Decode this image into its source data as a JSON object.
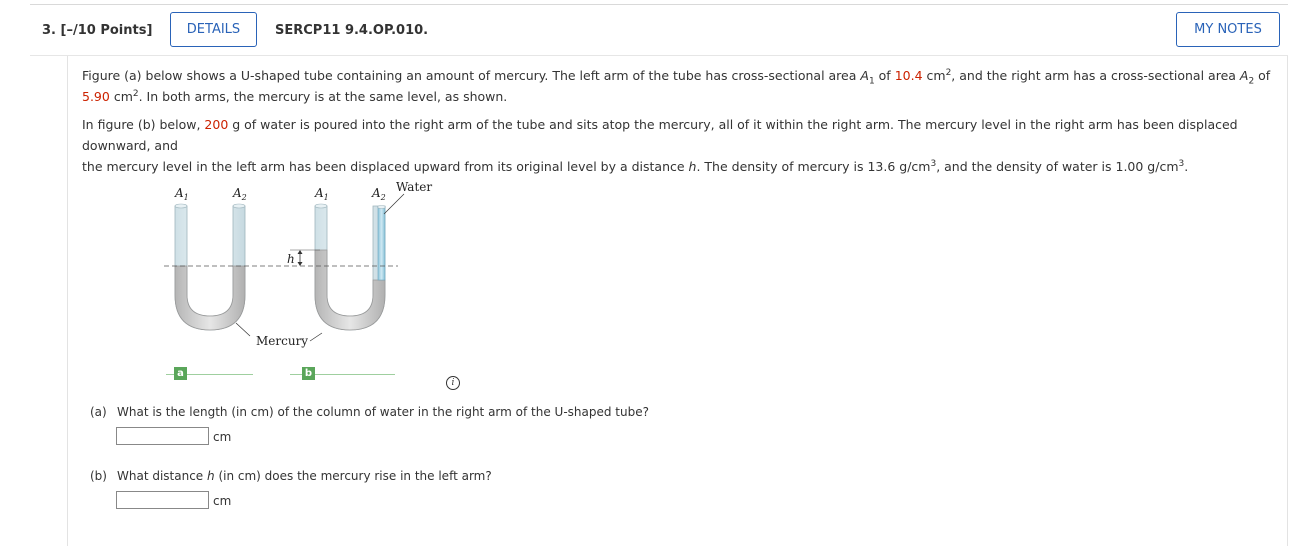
{
  "header": {
    "question_number": "3. [–/10 Points]",
    "details_label": "DETAILS",
    "question_id": "SERCP11 9.4.OP.010.",
    "my_notes_label": "MY NOTES"
  },
  "problem": {
    "p1_a": "Figure (a) below shows a U-shaped tube containing an amount of mercury. The left arm of the tube has cross-sectional area ",
    "p1_var1": "A",
    "p1_sub1": "1",
    "p1_b": " of ",
    "p1_val1": "10.4",
    "p1_c": " cm",
    "p1_sup1": "2",
    "p1_d": ", and the right arm has a cross-sectional area ",
    "p1_var2": "A",
    "p1_sub2": "2",
    "p1_e": " of",
    "p1_val2": "5.90",
    "p1_f": " cm",
    "p1_sup2": "2",
    "p1_g": ". In both arms, the mercury is at the same level, as shown.",
    "p2_a": "In figure (b) below, ",
    "p2_val": "200",
    "p2_b": " g of water is poured into the right arm of the tube and sits atop the mercury, all of it within the right arm. The mercury level in the right arm has been displaced downward, and",
    "p2_c": "the mercury level in the left arm has been displaced upward from its original level by a distance ",
    "p2_h": "h",
    "p2_d": ". The density of mercury is 13.6 g/cm",
    "p2_sup1": "3",
    "p2_e": ", and the density of water is 1.00 g/cm",
    "p2_sup2": "3",
    "p2_f": "."
  },
  "figure": {
    "label_a1": "A",
    "label_a1_sub": "1",
    "label_a2": "A",
    "label_a2_sub": "2",
    "label_b1": "A",
    "label_b1_sub": "1",
    "label_b2": "A",
    "label_b2_sub": "2",
    "water_label": "Water",
    "h_label": "h",
    "mercury_label": "Mercury",
    "tab_a": "a",
    "tab_b": "b",
    "colors": {
      "tube": "#d9e6ea",
      "mercury": "#c9c9c9",
      "water": "#a8d4e6",
      "tab": "#5aa65a"
    }
  },
  "info_icon": "i",
  "questions": [
    {
      "letter": "(a)",
      "text": "What is the length (in cm) of the column of water in the right arm of the U-shaped tube?",
      "value": "",
      "unit": "cm"
    },
    {
      "letter": "(b)",
      "text_a": "What distance ",
      "var": "h",
      "text_b": " (in cm) does the mercury rise in the left arm?",
      "value": "",
      "unit": "cm"
    }
  ]
}
